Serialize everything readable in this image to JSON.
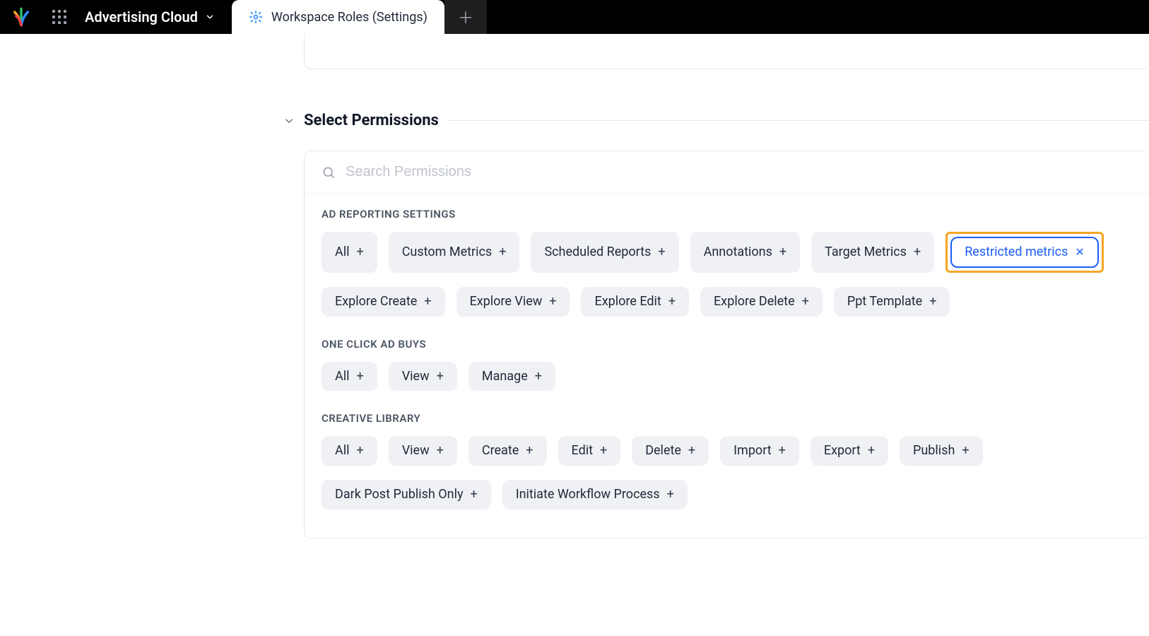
{
  "header": {
    "product": "Advertising Cloud",
    "active_tab": "Workspace Roles (Settings)"
  },
  "section": {
    "title": "Select Permissions"
  },
  "search": {
    "placeholder": "Search Permissions"
  },
  "groups": [
    {
      "title": "AD REPORTING SETTINGS",
      "chips": [
        {
          "label": "All",
          "selected": false
        },
        {
          "label": "Custom Metrics",
          "selected": false
        },
        {
          "label": "Scheduled Reports",
          "selected": false
        },
        {
          "label": "Annotations",
          "selected": false
        },
        {
          "label": "Target Metrics",
          "selected": false
        },
        {
          "label": "Restricted metrics",
          "selected": true,
          "highlighted": true
        },
        {
          "label": "Explore Create",
          "selected": false
        },
        {
          "label": "Explore View",
          "selected": false
        },
        {
          "label": "Explore Edit",
          "selected": false
        },
        {
          "label": "Explore Delete",
          "selected": false
        },
        {
          "label": "Ppt Template",
          "selected": false
        }
      ]
    },
    {
      "title": "ONE CLICK AD BUYS",
      "chips": [
        {
          "label": "All",
          "selected": false
        },
        {
          "label": "View",
          "selected": false
        },
        {
          "label": "Manage",
          "selected": false
        }
      ]
    },
    {
      "title": "CREATIVE LIBRARY",
      "chips": [
        {
          "label": "All",
          "selected": false
        },
        {
          "label": "View",
          "selected": false
        },
        {
          "label": "Create",
          "selected": false
        },
        {
          "label": "Edit",
          "selected": false
        },
        {
          "label": "Delete",
          "selected": false
        },
        {
          "label": "Import",
          "selected": false
        },
        {
          "label": "Export",
          "selected": false
        },
        {
          "label": "Publish",
          "selected": false
        },
        {
          "label": "Dark Post Publish Only",
          "selected": false
        },
        {
          "label": "Initiate Workflow Process",
          "selected": false
        }
      ]
    }
  ]
}
